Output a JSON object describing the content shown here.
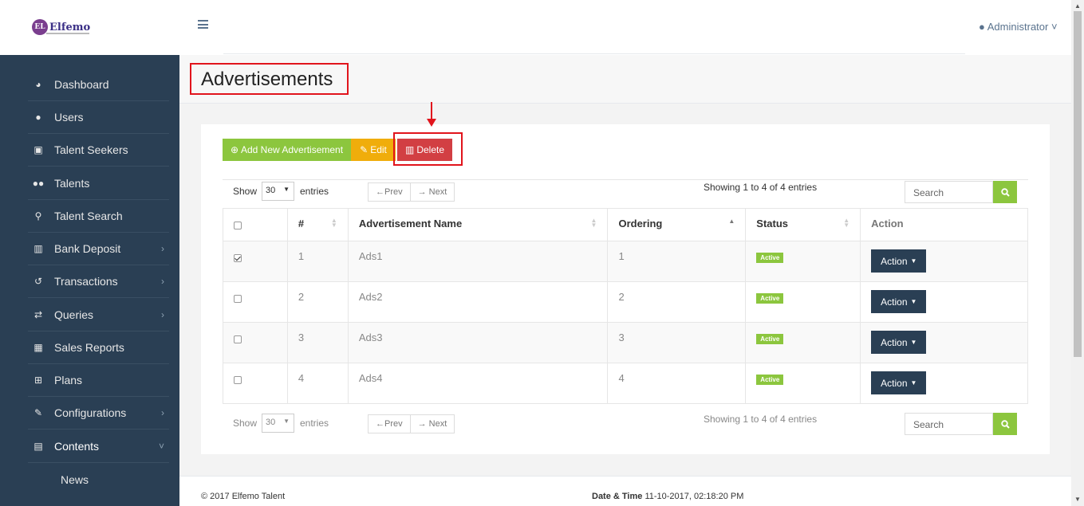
{
  "brand": {
    "logo_text": "Elfemo",
    "logo_mark": "EL"
  },
  "header": {
    "menu_icon": "hamburger-icon",
    "user_label": "Administrator",
    "user_icon": "user-icon"
  },
  "sidebar": {
    "items": [
      {
        "label": "Dashboard",
        "icon": "dashboard-icon",
        "glyph": "◕",
        "has_children": false
      },
      {
        "label": "Users",
        "icon": "user-icon",
        "glyph": "●",
        "has_children": false
      },
      {
        "label": "Talent Seekers",
        "icon": "briefcase-icon",
        "glyph": "▣",
        "has_children": false
      },
      {
        "label": "Talents",
        "icon": "users-icon",
        "glyph": "●●",
        "has_children": false
      },
      {
        "label": "Talent Search",
        "icon": "search-icon",
        "glyph": "⚲",
        "has_children": false
      },
      {
        "label": "Bank Deposit",
        "icon": "bank-icon",
        "glyph": "▥",
        "has_children": true
      },
      {
        "label": "Transactions",
        "icon": "history-icon",
        "glyph": "↺",
        "has_children": true
      },
      {
        "label": "Queries",
        "icon": "retweet-icon",
        "glyph": "⇄",
        "has_children": true
      },
      {
        "label": "Sales Reports",
        "icon": "table-icon",
        "glyph": "▦",
        "has_children": false
      },
      {
        "label": "Plans",
        "icon": "cart-icon",
        "glyph": "⊞",
        "has_children": false
      },
      {
        "label": "Configurations",
        "icon": "wrench-icon",
        "glyph": "✎",
        "has_children": true
      },
      {
        "label": "Contents",
        "icon": "newspaper-icon",
        "glyph": "▤",
        "has_children": true,
        "expanded": true
      }
    ],
    "sub_items": [
      {
        "label": "News"
      }
    ]
  },
  "page": {
    "title": "Advertisements"
  },
  "toolbar": {
    "add_label": "Add New Advertisement",
    "edit_label": "Edit",
    "delete_label": "Delete"
  },
  "table_controls": {
    "show_label": "Show",
    "page_length": "30",
    "entries_label": "entries",
    "prev_label": "←Prev",
    "next_label": "→ Next",
    "info": "Showing 1 to 4 of 4 entries",
    "search_placeholder": "Search"
  },
  "table": {
    "columns": [
      "#",
      "Advertisement Name",
      "Ordering",
      "Status",
      "Action"
    ],
    "rows": [
      {
        "checked": true,
        "num": "1",
        "name": "Ads1",
        "ordering": "1",
        "status": "Active",
        "action": "Action"
      },
      {
        "checked": false,
        "num": "2",
        "name": "Ads2",
        "ordering": "2",
        "status": "Active",
        "action": "Action"
      },
      {
        "checked": false,
        "num": "3",
        "name": "Ads3",
        "ordering": "3",
        "status": "Active",
        "action": "Action"
      },
      {
        "checked": false,
        "num": "4",
        "name": "Ads4",
        "ordering": "4",
        "status": "Active",
        "action": "Action"
      }
    ]
  },
  "footer": {
    "copyright": "© 2017 Elfemo Talent",
    "datetime_label": "Date & Time",
    "datetime_value": "11-10-2017, 02:18:20 PM"
  },
  "colors": {
    "sidebar_bg": "#2a3f54",
    "add_button": "#8cc63e",
    "edit_button": "#f0ad0b",
    "delete_button": "#d23f43",
    "highlight": "#e1141c",
    "status_active": "#8cc63e"
  }
}
